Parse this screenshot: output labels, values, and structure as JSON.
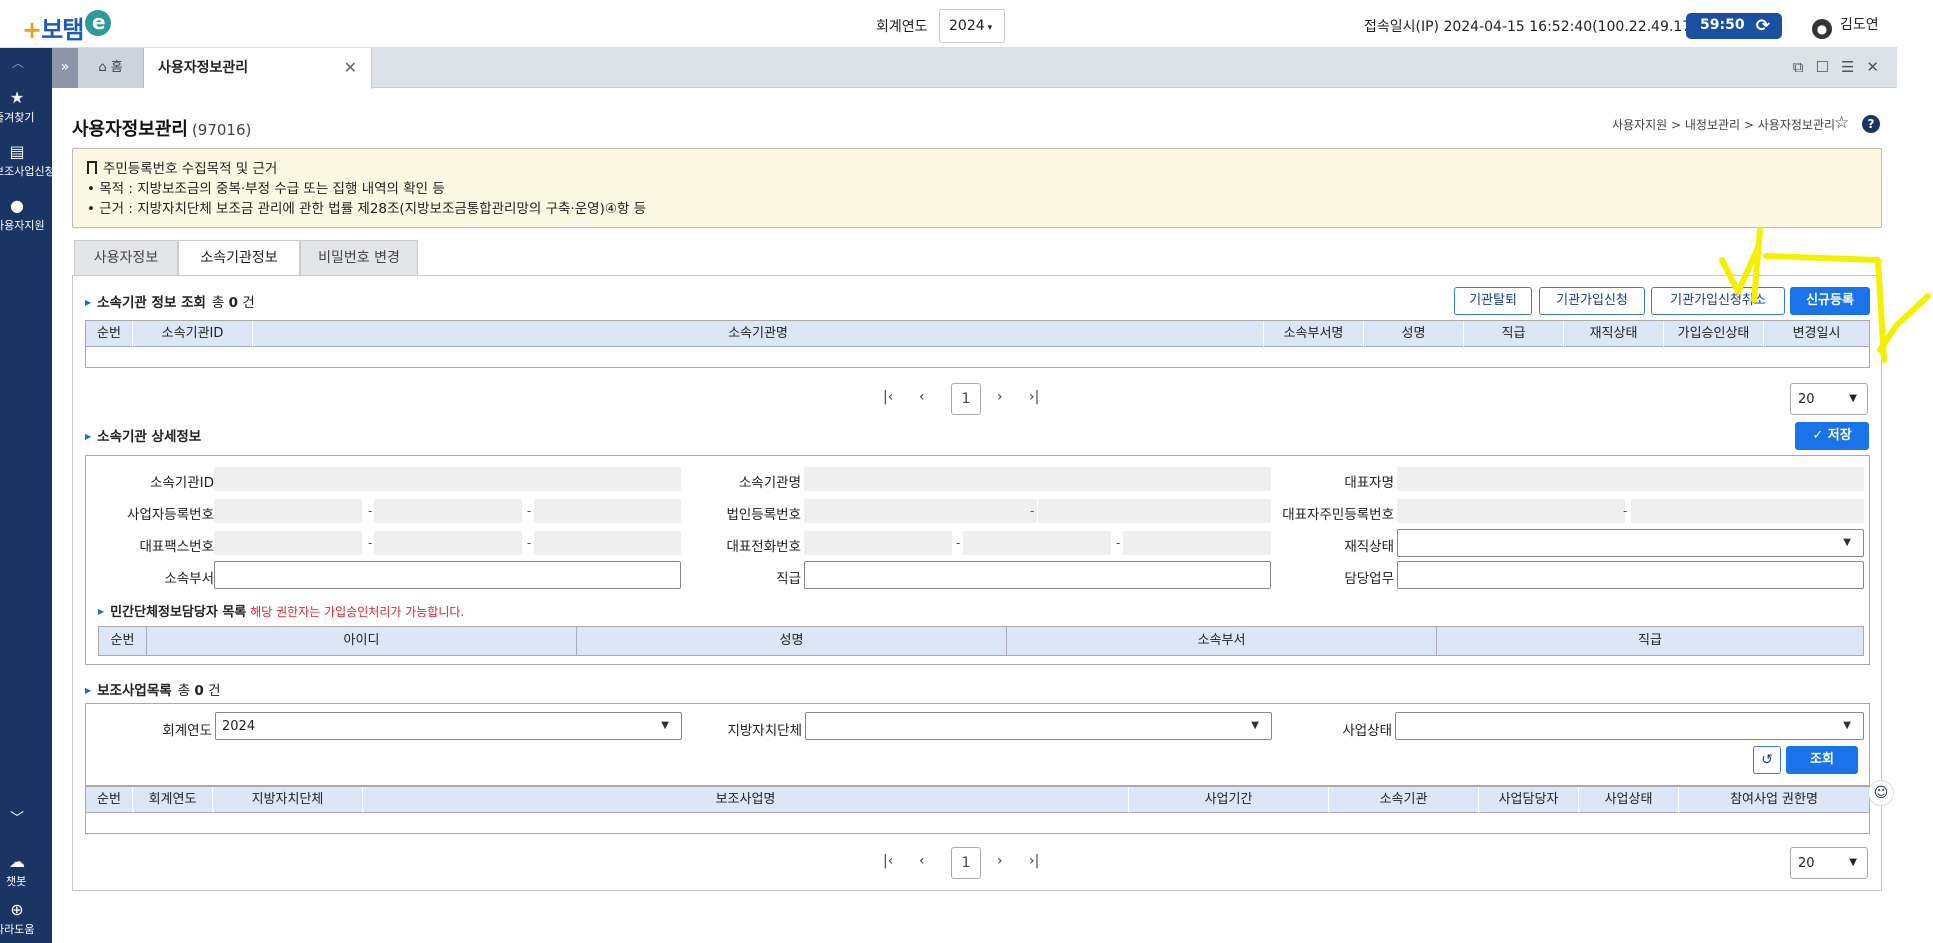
{
  "header": {
    "logo_main": "보탬",
    "logo_e": "e",
    "fiscal_label": "회계연도",
    "fiscal_value": "2024",
    "login_info": "접속일시(IP)  2024-04-15 16:52:40(100.22.49.174)",
    "timer": "59:50",
    "user_name": "김도연"
  },
  "sidebar": {
    "items": [
      {
        "label": "즐겨찾기",
        "icon": "star-icon"
      },
      {
        "label": "보조사업신청",
        "icon": "document-icon"
      },
      {
        "label": "사용자지원",
        "icon": "user-icon"
      },
      {
        "label": "챗봇",
        "icon": "chatbot-icon"
      },
      {
        "label": "나라도움",
        "icon": "globe-icon"
      }
    ]
  },
  "tabs": {
    "home": "홈",
    "active": "사용자정보관리"
  },
  "page": {
    "title": "사용자정보관리",
    "code": "(97016)",
    "breadcrumb": "사용자지원 > 내정보관리 > 사용자정보관리"
  },
  "notice": {
    "title": "주민등록번호 수집목적 및 근거",
    "purpose": "• 목적 : 지방보조금의 중복·부정 수급 또는 집행 내역의 확인 등",
    "basis": "• 근거 : 지방자치단체 보조금 관리에 관한 법률 제28조(지방보조금통합관리망의 구축·운영)④항 등"
  },
  "subtabs": [
    "사용자정보",
    "소속기관정보",
    "비밀번호 변경"
  ],
  "org_list": {
    "title": "소속기관 정보 조회",
    "count_prefix": "총",
    "count": "0",
    "count_suffix": "건",
    "buttons": {
      "withdraw": "기관탈퇴",
      "join": "기관가입신청",
      "cancel_join": "기관가입신청취소",
      "new": "신규등록"
    },
    "columns": [
      "순번",
      "소속기관ID",
      "소속기관명",
      "소속부서명",
      "성명",
      "직급",
      "재직상태",
      "가입승인상태",
      "변경일시"
    ],
    "page": "1",
    "page_size": "20"
  },
  "org_detail": {
    "title": "소속기관 상세정보",
    "save": "저장",
    "labels": {
      "org_id": "소속기관ID",
      "org_name": "소속기관명",
      "ceo": "대표자명",
      "biz_no": "사업자등록번호",
      "corp_no": "법인등록번호",
      "ceo_rrn": "대표자주민등록번호",
      "fax": "대표팩스번호",
      "phone": "대표전화번호",
      "status": "재직상태",
      "dept": "소속부서",
      "rank": "직급",
      "duty": "담당업무"
    },
    "dash": "-"
  },
  "manager_list": {
    "title": "민간단체정보담당자 목록",
    "note": "해당 권한자는 가입승인처리가 가능합니다.",
    "columns": [
      "순번",
      "아이디",
      "성명",
      "소속부서",
      "직급"
    ]
  },
  "project_list": {
    "title": "보조사업목록",
    "count_prefix": "총",
    "count": "0",
    "count_suffix": "건",
    "filters": {
      "fiscal_label": "회계연도",
      "fiscal_value": "2024",
      "local_gov_label": "지방자치단체",
      "status_label": "사업상태"
    },
    "search": "조회",
    "columns": [
      "순번",
      "회계연도",
      "지방자치단체",
      "보조사업명",
      "사업기간",
      "소속기관",
      "사업담당자",
      "사업상태",
      "참여사업 권한명"
    ],
    "page": "1",
    "page_size": "20"
  },
  "colors": {
    "sidebar": "#1a3463",
    "primary": "#1a73e8",
    "highlight": "#f5f000"
  }
}
